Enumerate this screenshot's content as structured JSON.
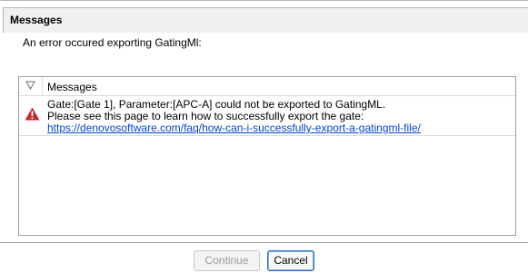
{
  "header": {
    "title": "Messages"
  },
  "error_intro": "An error occured exporting GatingMl:",
  "grid": {
    "column_title": "Messages",
    "rows": [
      {
        "severity_icon": "warning-triangle-icon",
        "line1": "Gate:[Gate 1], Parameter:[APC-A] could not be exported to GatingML.",
        "line2": "Please see this page to learn how to successfully export the gate:",
        "link": "https://denovosoftware.com/faq/how-can-i-successfully-export-a-gatingml-file/"
      }
    ]
  },
  "buttons": {
    "continue_label": "Continue",
    "continue_enabled": false,
    "cancel_label": "Cancel"
  },
  "colors": {
    "warning": "#c4262e",
    "link": "#0645c8",
    "focus_border": "#2a6fb8"
  }
}
